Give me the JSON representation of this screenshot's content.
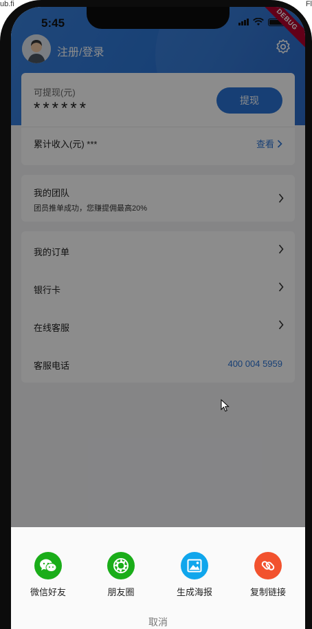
{
  "browser_strip": {
    "left": "ub.fi",
    "right": "Fl"
  },
  "status_bar": {
    "time": "5:45"
  },
  "debug_banner": "DEBUG",
  "header": {
    "login_label": "注册/登录"
  },
  "balance_card": {
    "withdrawable_label": "可提现(元)",
    "withdrawable_value": "******",
    "withdraw_button": "提现",
    "cumulative_label": "累计收入(元) ***",
    "view_link": "查看"
  },
  "team_card": {
    "title": "我的团队",
    "subtitle": "团员推单成功，您赚提佣最高20%"
  },
  "menu": {
    "orders": "我的订单",
    "bank_card": "银行卡",
    "online_service": "在线客服",
    "service_phone_label": "客服电话",
    "service_phone_value": "400 004 5959"
  },
  "share_sheet": {
    "items": [
      {
        "label": "微信好友",
        "icon": "wechat-icon",
        "color": "#1aad19"
      },
      {
        "label": "朋友圈",
        "icon": "moments-icon",
        "color": "#1aad19"
      },
      {
        "label": "生成海报",
        "icon": "poster-image-icon",
        "color": "#10a6ec"
      },
      {
        "label": "复制链接",
        "icon": "link-icon",
        "color": "#f2522e"
      }
    ],
    "cancel": "取消"
  },
  "colors": {
    "primary": "#2a74d6",
    "debug": "#b3002d"
  }
}
